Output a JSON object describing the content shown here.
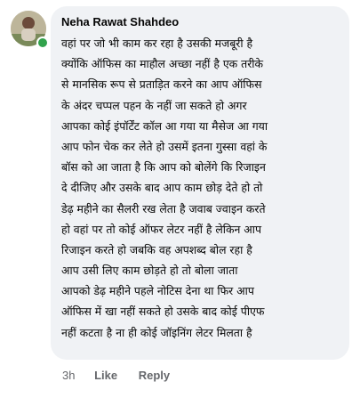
{
  "comment": {
    "author": "Neha Rawat Shahdeo",
    "lines": [
      "वहां पर जो भी काम कर रहा है उसकी मजबूरी है",
      "क्योंकि ऑफिस का माहौल अच्छा नहीं है एक तरीके",
      "से मानसिक रूप से प्रताड़ित करने का आप ऑफिस",
      "के अंदर चप्पल पहन के नहीं जा सकते हो अगर",
      "आपका कोई इंपॉर्टेंट कॉल आ गया या मैसेज आ गया",
      "आप फोन चेक कर लेते हो उसमें इतना  गुस्सा वहां के",
      "बॉस को आ जाता है कि आप को बोलेंगे कि रिजाइन",
      "दे दीजिए और उसके बाद आप काम छोड़ देते हो तो",
      "डेढ़ महीने का सैलरी रख लेता है जवाब ज्वाइन करते",
      "हो वहां पर तो कोई ऑफर लेटर नहीं है लेकिन आप",
      "रिजाइन करते हो जबकि वह अपशब्द बोल रहा है",
      "आप उसी लिए काम छोड़ते हो तो बोला जाता",
      "आपको डेढ़ महीने पहले नोटिस देना था फिर आप",
      "ऑफिस में खा नहीं सकते हो उसके बाद कोई पीएफ",
      "नहीं कटता है ना ही कोई जॉइनिंग लेटर मिलता है"
    ]
  },
  "actions": {
    "time": "3h",
    "like": "Like",
    "reply": "Reply"
  },
  "colors": {
    "bubble_bg": "#f0f2f5",
    "text": "#050505",
    "secondary_text": "#65676b",
    "online": "#31a24c"
  }
}
